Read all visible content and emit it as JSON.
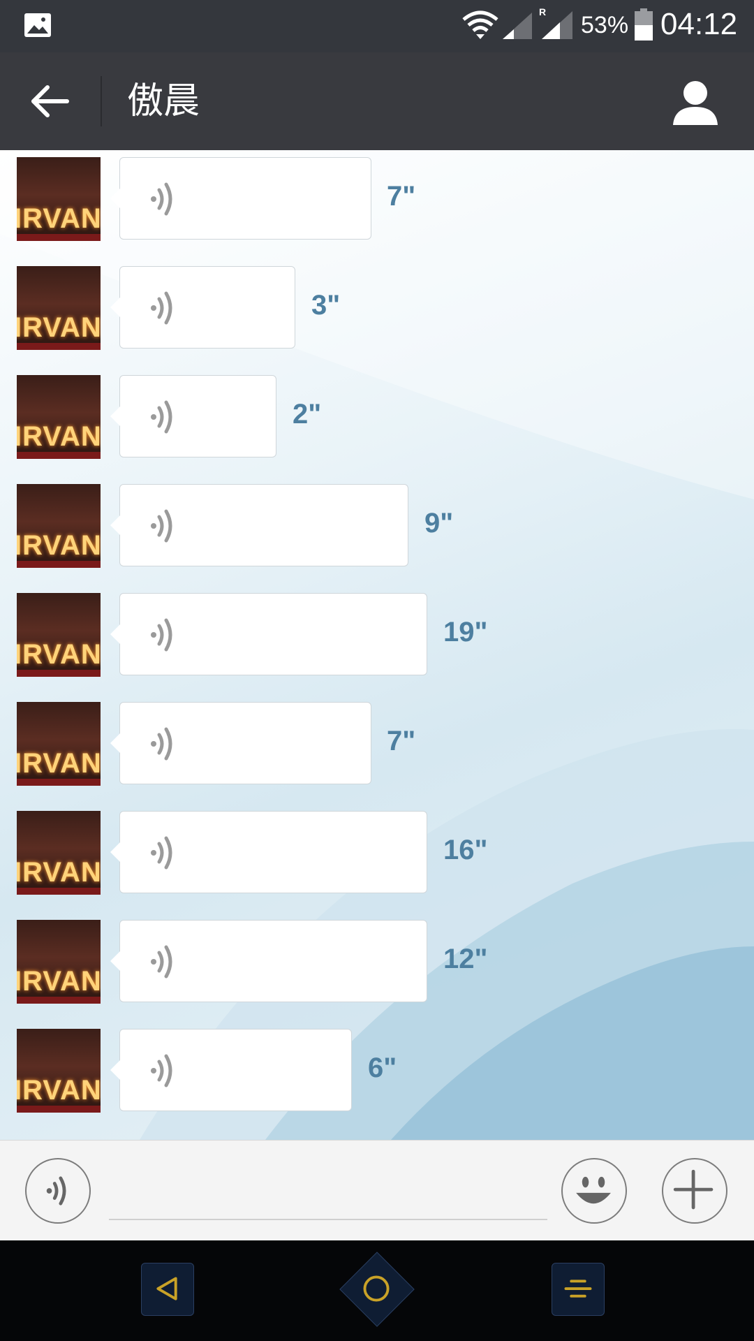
{
  "status_bar": {
    "battery_percent": "53%",
    "time": "04:12",
    "icons": [
      "gallery-icon",
      "wifi-icon",
      "signal-icon",
      "signal-roaming-icon",
      "battery-icon"
    ]
  },
  "header": {
    "title": "傲晨",
    "icons": [
      "back-arrow-icon",
      "profile-icon"
    ]
  },
  "chat": {
    "avatar_text": "IRVANA",
    "messages": [
      {
        "duration": "7\""
      },
      {
        "duration": "3\""
      },
      {
        "duration": "2\""
      },
      {
        "duration": "9\""
      },
      {
        "duration": "19\""
      },
      {
        "duration": "7\""
      },
      {
        "duration": "16\""
      },
      {
        "duration": "12\""
      },
      {
        "duration": "6\""
      }
    ]
  },
  "input_bar": {
    "text_value": "",
    "icons": [
      "voice-toggle-icon",
      "emoji-icon",
      "plus-icon"
    ]
  },
  "nav_bar": {
    "icons": [
      "nav-back-icon",
      "nav-home-icon",
      "nav-recents-icon"
    ],
    "accent_color": "#c9a227"
  },
  "colors": {
    "header_bg": "#393a3f",
    "duration_text": "#4d7fa0",
    "bubble_bg": "#ffffff"
  }
}
